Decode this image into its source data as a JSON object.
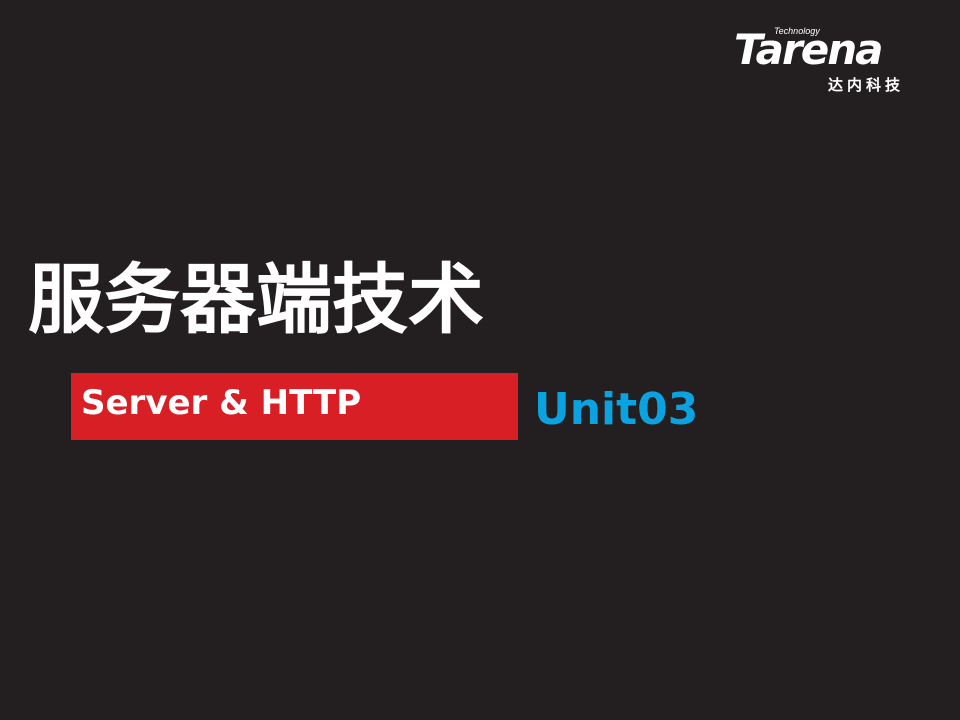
{
  "logo": {
    "technology": "Technology",
    "brand": "Tarena",
    "brand_cn": "达内科技"
  },
  "slide": {
    "title": "服务器端技术",
    "subtitle": "Server & HTTP",
    "unit": "Unit03"
  },
  "colors": {
    "background": "#231f20",
    "subtitle_bar": "#d91f26",
    "unit_text": "#0ba2e0",
    "text": "#ffffff"
  }
}
